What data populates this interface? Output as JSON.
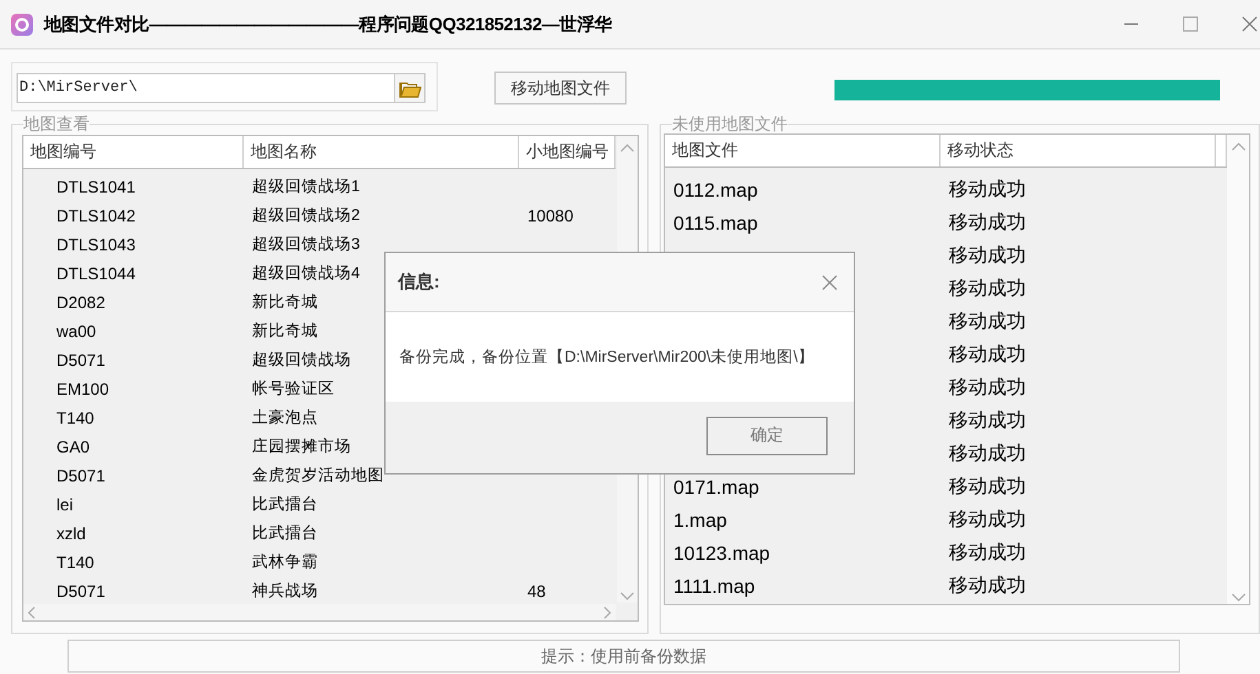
{
  "window": {
    "title": "地图文件对比————————————程序问题QQ321852132—世浮华"
  },
  "path_field": {
    "value": "D:\\MirServer\\"
  },
  "move_button": {
    "label": "移动地图文件"
  },
  "progress": {
    "level": 1
  },
  "map_view": {
    "title": "地图查看",
    "columns": [
      "地图编号",
      "地图名称",
      "小地图编号"
    ],
    "rows": [
      {
        "map_id": "DTLS1041",
        "map_name": "超级回馈战场1"
      },
      {
        "map_id": "DTLS1042",
        "map_name": "超级回馈战场2",
        "minimap_id": "10080"
      },
      {
        "map_id": "DTLS1043",
        "map_name": "超级回馈战场3"
      },
      {
        "map_id": "DTLS1044",
        "map_name": "超级回馈战场4"
      },
      {
        "map_id": "D2082",
        "map_name": "新比奇城"
      },
      {
        "map_id": "wa00",
        "map_name": "新比奇城"
      },
      {
        "map_id": "D5071",
        "map_name": "超级回馈战场"
      },
      {
        "map_id": "EM100",
        "map_name": "帐号验证区"
      },
      {
        "map_id": "T140",
        "map_name": "土豪泡点"
      },
      {
        "map_id": "GA0",
        "map_name": "庄园摆摊市场"
      },
      {
        "map_id": "D5071",
        "map_name": "金虎贺岁活动地图"
      },
      {
        "map_id": "lei",
        "map_name": "比武擂台"
      },
      {
        "map_id": "xzld",
        "map_name": "比武擂台"
      },
      {
        "map_id": "T140",
        "map_name": "武林争霸"
      },
      {
        "map_id": "D5071",
        "map_name": "神兵战场",
        "minimap_id": "48"
      }
    ]
  },
  "unused_files": {
    "title": "未使用地图文件",
    "columns": [
      "地图文件",
      "移动状态"
    ],
    "rows": [
      {
        "file": "0112.map",
        "status": "移动成功"
      },
      {
        "file": "0115.map",
        "status": "移动成功"
      },
      {
        "status": "移动成功"
      },
      {
        "status": "移动成功"
      },
      {
        "status": "移动成功"
      },
      {
        "status": "移动成功"
      },
      {
        "status": "移动成功"
      },
      {
        "status": "移动成功"
      },
      {
        "status": "移动成功"
      },
      {
        "file": "0171.map",
        "status": "移动成功"
      },
      {
        "file": "1.map",
        "status": "移动成功"
      },
      {
        "file": "10123.map",
        "status": "移动成功"
      },
      {
        "file": "1111.map",
        "status": "移动成功"
      }
    ]
  },
  "hint_bar": {
    "text": "提示：使用前备份数据"
  },
  "dialog": {
    "title": "信息:",
    "message": "备份完成，备份位置【D:\\MirServer\\Mir200\\未使用地图\\】",
    "button": "确定"
  }
}
